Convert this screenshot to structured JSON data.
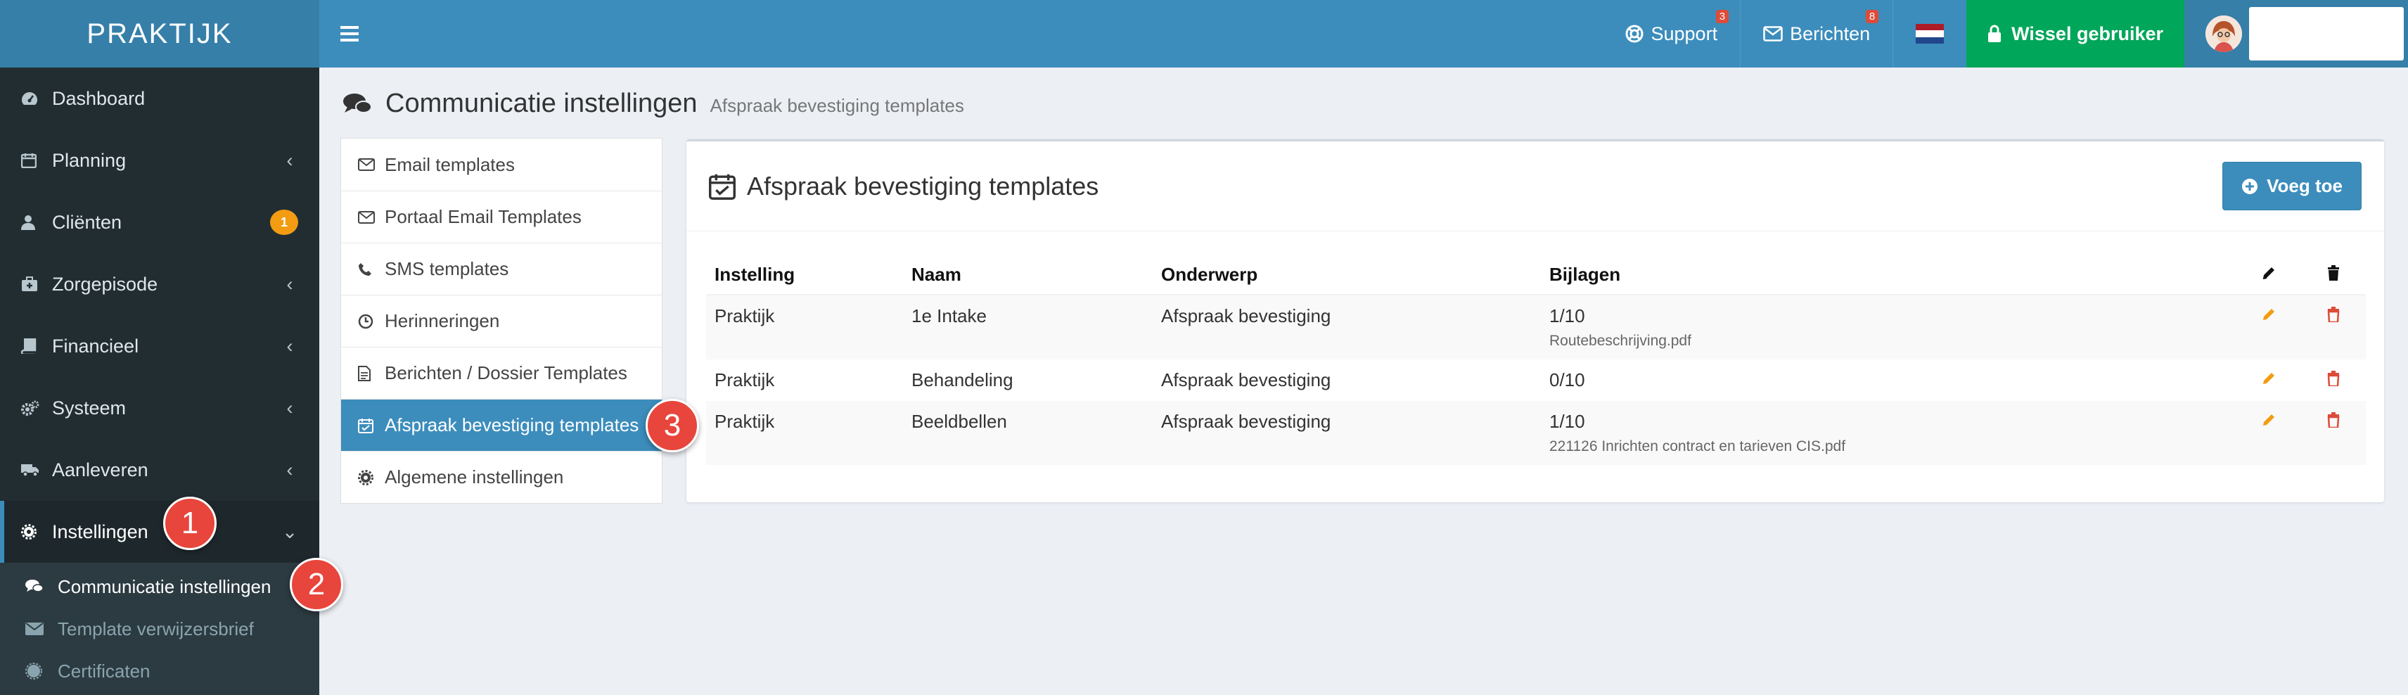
{
  "brand": {
    "logo": "PRAKTIJK"
  },
  "topbar": {
    "support_label": "Support",
    "support_badge": "3",
    "berichten_label": "Berichten",
    "berichten_badge": "8",
    "wissel_label": "Wissel gebruiker",
    "colors": {
      "header": "#3c8dbc",
      "logo_bg": "#367fa9",
      "wissel": "#00a65a",
      "badge": "#dd4b39"
    }
  },
  "sidebar": {
    "items": [
      {
        "label": "Dashboard",
        "icon": "dashboard-icon"
      },
      {
        "label": "Planning",
        "icon": "calendar-icon"
      },
      {
        "label": "Cliënten",
        "icon": "user-icon",
        "badge": "1"
      },
      {
        "label": "Zorgepisode",
        "icon": "medkit-icon"
      },
      {
        "label": "Financieel",
        "icon": "book-icon"
      },
      {
        "label": "Systeem",
        "icon": "cogs-icon"
      },
      {
        "label": "Aanleveren",
        "icon": "truck-icon"
      },
      {
        "label": "Instellingen",
        "icon": "gear-icon"
      }
    ],
    "submenu": [
      {
        "label": "Communicatie instellingen",
        "icon": "comments-icon"
      },
      {
        "label": "Template verwijzersbrief",
        "icon": "envelope-icon"
      },
      {
        "label": "Certificaten",
        "icon": "certificate-icon"
      }
    ]
  },
  "callouts": [
    "1",
    "2",
    "3"
  ],
  "content": {
    "title": "Communicatie instellingen",
    "subtitle": "Afspraak bevestiging templates"
  },
  "tabs": [
    {
      "label": "Email templates",
      "icon": "envelope-icon"
    },
    {
      "label": "Portaal Email Templates",
      "icon": "envelope-icon"
    },
    {
      "label": "SMS templates",
      "icon": "phone-icon"
    },
    {
      "label": "Herinneringen",
      "icon": "clock-icon"
    },
    {
      "label": "Berichten / Dossier Templates",
      "icon": "file-icon"
    },
    {
      "label": "Afspraak bevestiging templates",
      "icon": "calendar-check-icon"
    },
    {
      "label": "Algemene instellingen",
      "icon": "gear-icon"
    }
  ],
  "box": {
    "title": "Afspraak bevestiging templates",
    "add_label": "Voeg toe",
    "columns": [
      "Instelling",
      "Naam",
      "Onderwerp",
      "Bijlagen"
    ],
    "rows": [
      {
        "instelling": "Praktijk",
        "naam": "1e Intake",
        "onderwerp": "Afspraak bevestiging",
        "bijlagen": "1/10",
        "bestand": "Routebeschrijving.pdf"
      },
      {
        "instelling": "Praktijk",
        "naam": "Behandeling",
        "onderwerp": "Afspraak bevestiging",
        "bijlagen": "0/10",
        "bestand": ""
      },
      {
        "instelling": "Praktijk",
        "naam": "Beeldbellen",
        "onderwerp": "Afspraak bevestiging",
        "bijlagen": "1/10",
        "bestand": "221126 Inrichten contract en tarieven CIS.pdf"
      }
    ]
  }
}
